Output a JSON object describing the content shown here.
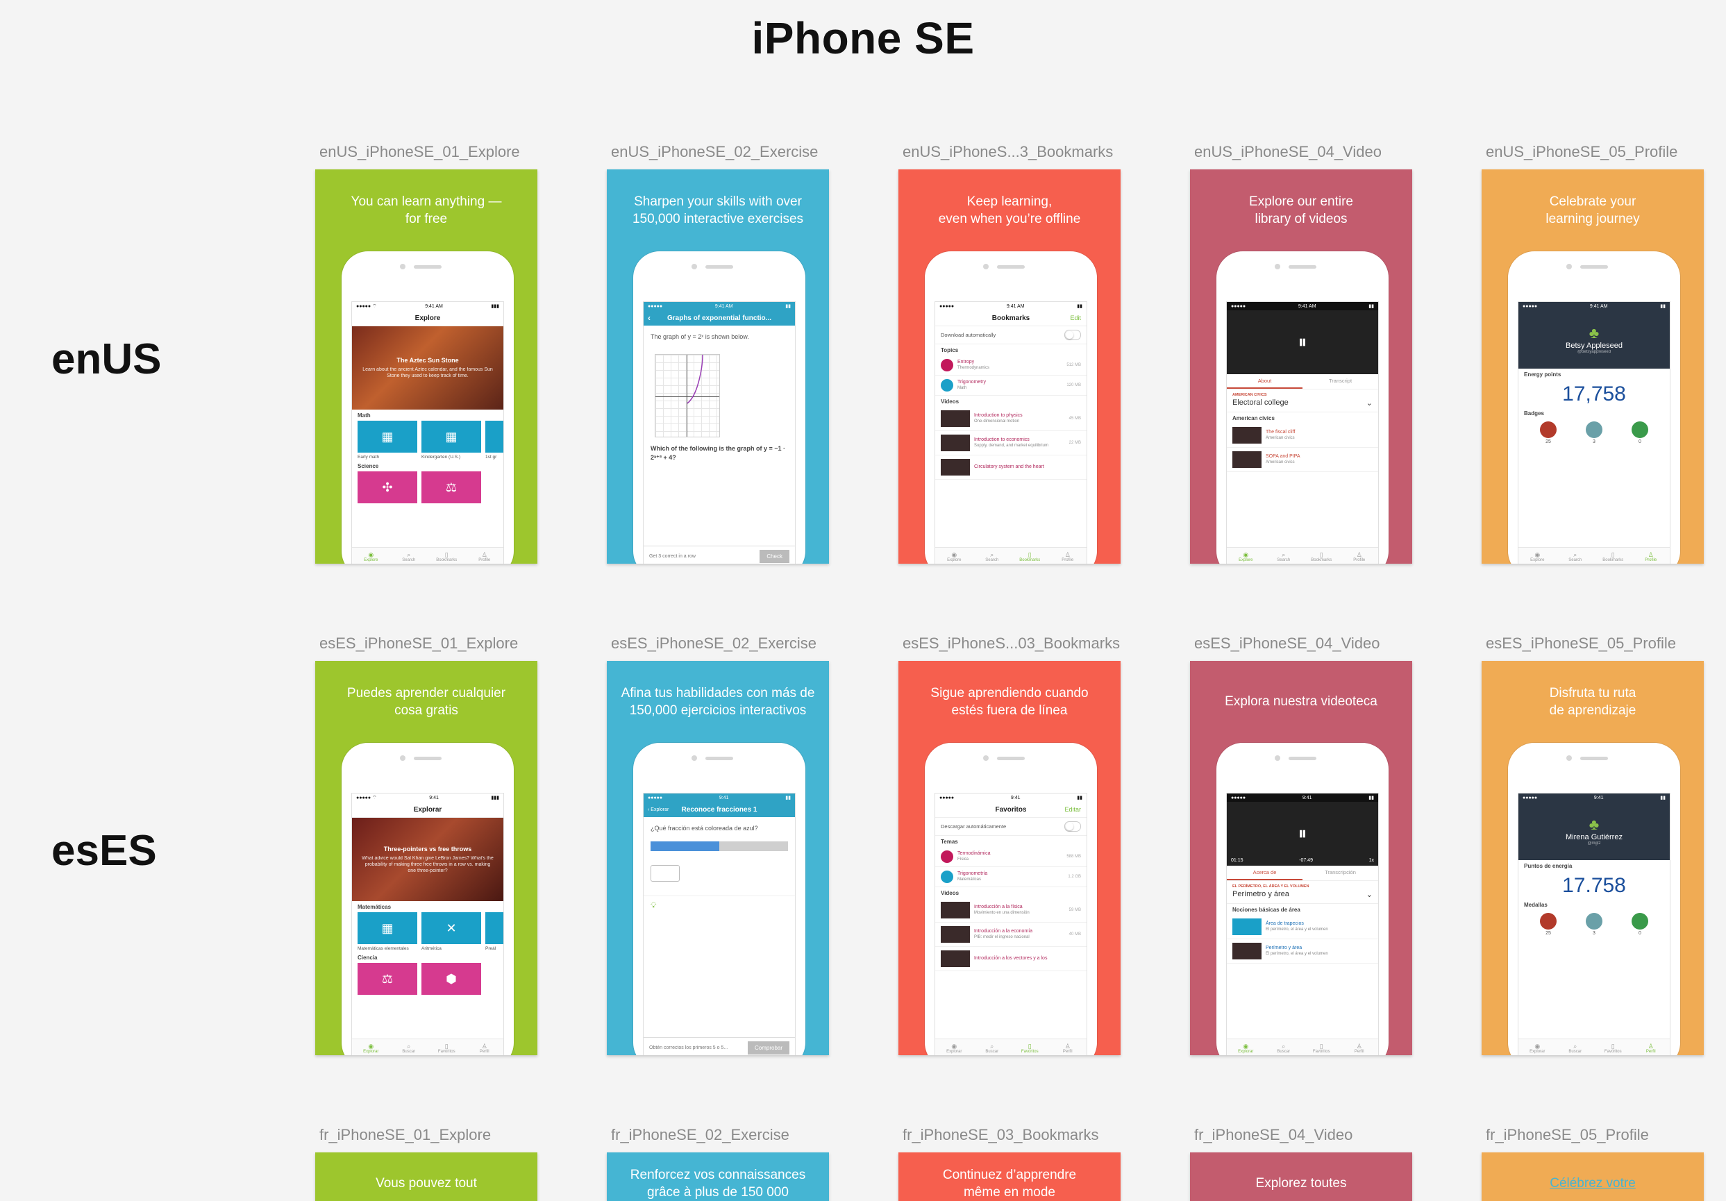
{
  "title": "iPhone SE",
  "row_labels": [
    "enUS",
    "esES"
  ],
  "colors": {
    "explore": "#9dc62d",
    "exercise": "#45b5d3",
    "bookmarks": "#f65f4e",
    "video": "#c35c6e",
    "profile": "#f0ab54"
  },
  "enUS": {
    "explore": {
      "name": "enUS_iPhoneSE_01_Explore",
      "caption": "You can learn anything —\nfor free",
      "nav": "Explore",
      "time": "9:41 AM",
      "hero_title": "The Aztec Sun Stone",
      "hero_desc": "Learn about the ancient Aztec calendar, and the famous Sun Stone they used to keep track of time.",
      "sec1": "Math",
      "tiles1": [
        "Early math",
        "Kindergarten (U.S.)",
        "1st gr"
      ],
      "sec2": "Science",
      "tabs": [
        "Explore",
        "Search",
        "Bookmarks",
        "Profile"
      ]
    },
    "exercise": {
      "name": "enUS_iPhoneSE_02_Exercise",
      "caption": "Sharpen your skills with over\n150,000 interactive exercises",
      "nav": "Graphs of exponential functio...",
      "time": "9:41 AM",
      "q1": "The graph of y = 2ˣ is shown below.",
      "q2": "Which of the following is the graph of y = −1 · 2ˣ⁺³ + 4?",
      "foot": "Get 3 correct in a row",
      "btn": "Check"
    },
    "bookmarks": {
      "name": "enUS_iPhoneS...3_Bookmarks",
      "caption": "Keep learning,\neven when you’re offline",
      "nav": "Bookmarks",
      "edit": "Edit",
      "time": "9:41 AM",
      "download": "Download automatically",
      "topics": "Topics",
      "t1": "Entropy",
      "t1s": "Thermodynamics",
      "t1z": "512 MB",
      "t2": "Trigonometry",
      "t2s": "Math",
      "t2z": "120 MB",
      "videos": "Videos",
      "v1": "Introduction to physics",
      "v1s": "One-dimensional motion",
      "v1z": "45 MB",
      "v2": "Introduction to economics",
      "v2s": "Supply, demand, and market equilibrium",
      "v2z": "22 MB",
      "v3": "Circulatory system and the heart",
      "tabs": [
        "Explore",
        "Search",
        "Bookmarks",
        "Profile"
      ]
    },
    "video": {
      "name": "enUS_iPhoneSE_04_Video",
      "caption": "Explore our entire\nlibrary of videos",
      "time": "9:41 AM",
      "tab_about": "About",
      "tab_trans": "Transcript",
      "topic": "AMERICAN CIVICS",
      "title": "Electoral college",
      "section": "American civics",
      "r1": "The fiscal cliff",
      "r1s": "American civics",
      "r2": "SOPA and PIPA",
      "r2s": "American civics",
      "tabs": [
        "Explore",
        "Search",
        "Bookmarks",
        "Profile"
      ]
    },
    "profile": {
      "name": "enUS_iPhoneSE_05_Profile",
      "caption": "Celebrate your\nlearning journey",
      "time": "9:41 AM",
      "user": "Betsy Appleseed",
      "handle": "@betsyappleseed",
      "pts_label": "Energy points",
      "points": "17,758",
      "badges_label": "Badges",
      "b": [
        "25",
        "3",
        "0"
      ],
      "tabs": [
        "Explore",
        "Search",
        "Bookmarks",
        "Profile"
      ]
    }
  },
  "esES": {
    "explore": {
      "name": "esES_iPhoneSE_01_Explore",
      "caption": "Puedes aprender cualquier\ncosa gratis",
      "nav": "Explorar",
      "time": "9:41",
      "hero_title": "Three-pointers vs free throws",
      "hero_desc": "What advice would Sal Khan give LeBron James? What's the probability of making three free throws in a row vs. making one three-pointer?",
      "sec1": "Matemáticas",
      "tiles1": [
        "Matemáticas elementales",
        "Aritmética",
        "Preál"
      ],
      "sec2": "Ciencia",
      "tabs": [
        "Explorar",
        "Buscar",
        "Favoritos",
        "Perfil"
      ]
    },
    "exercise": {
      "name": "esES_iPhoneSE_02_Exercise",
      "caption": "Afina tus habilidades con más de\n150,000 ejercicios interactivos",
      "nav": "Reconoce fracciones 1",
      "back": "Explorar",
      "time": "9:41",
      "q1": "¿Qué fracción está coloreada de azul?",
      "foot": "Obtén correctos los primeros 5 o 5...",
      "btn": "Comprobar"
    },
    "bookmarks": {
      "name": "esES_iPhoneS...03_Bookmarks",
      "caption": "Sigue aprendiendo cuando\nestés fuera de línea",
      "nav": "Favoritos",
      "edit": "Editar",
      "time": "9:41",
      "download": "Descargar automáticamente",
      "topics": "Temas",
      "t1": "Termodinámica",
      "t1s": "Física",
      "t1z": "588 MB",
      "t2": "Trigonometría",
      "t2s": "Matemáticas",
      "t2z": "1.2 GB",
      "videos": "Videos",
      "v1": "Introducción a la física",
      "v1s": "Movimiento en una dimensión",
      "v1z": "59 MB",
      "v2": "Introducción a la economía",
      "v2s": "PIB: medir el ingreso nacional",
      "v2z": "40 MB",
      "v3": "Introducción a los vectores y a los",
      "tabs": [
        "Explorar",
        "Buscar",
        "Favoritos",
        "Perfil"
      ]
    },
    "video": {
      "name": "esES_iPhoneSE_04_Video",
      "caption": "Explora nuestra videoteca",
      "time": "9:41",
      "elapsed": "01:15",
      "remaining": "-07:49",
      "speed": "1x",
      "tab_about": "Acerca de",
      "tab_trans": "Transcripción",
      "topic": "EL PERÍMETRO, EL ÁREA Y EL VOLUMEN",
      "title": "Perímetro y área",
      "section": "Nociones básicas de área",
      "r1": "Área de trapecios",
      "r1s": "El perímetro, el área y el volumen",
      "r2": "Perímetro y área",
      "r2s": "El perímetro, el área y el volumen",
      "tabs": [
        "Explorar",
        "Buscar",
        "Favoritos",
        "Perfil"
      ]
    },
    "profile": {
      "name": "esES_iPhoneSE_05_Profile",
      "caption": "Disfruta tu ruta\nde aprendizaje",
      "time": "9:41",
      "user": "Mirena Gutiérrez",
      "handle": "@mgtz",
      "pts_label": "Puntos de energía",
      "points": "17.758",
      "badges_label": "Medallas",
      "b": [
        "25",
        "3",
        "0"
      ],
      "tabs": [
        "Explorar",
        "Buscar",
        "Favoritos",
        "Perfil"
      ]
    }
  },
  "fr": {
    "explore": {
      "name": "fr_iPhoneSE_01_Explore",
      "caption": "Vous pouvez tout"
    },
    "exercise": {
      "name": "fr_iPhoneSE_02_Exercise",
      "caption": "Renforcez vos connaissances\ngrâce à plus de 150 000"
    },
    "bookmarks": {
      "name": "fr_iPhoneSE_03_Bookmarks",
      "caption": "Continuez d’apprendre\nmême en mode"
    },
    "video": {
      "name": "fr_iPhoneSE_04_Video",
      "caption": "Explorez toutes"
    },
    "profile": {
      "name": "fr_iPhoneSE_05_Profile",
      "caption": "Célébrez votre"
    }
  }
}
